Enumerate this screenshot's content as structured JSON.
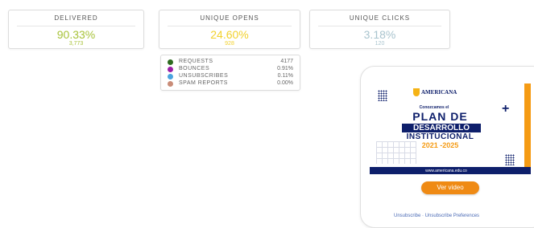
{
  "cards": [
    {
      "label": "DELIVERED",
      "value": "90.33%",
      "count": "3,773"
    },
    {
      "label": "UNIQUE OPENS",
      "value": "24.60%",
      "count": "928"
    },
    {
      "label": "UNIQUE CLICKS",
      "value": "3.18%",
      "count": "120"
    }
  ],
  "stats": [
    {
      "name": "REQUESTS",
      "value": "4177",
      "color": "#2d6a1f"
    },
    {
      "name": "BOUNCES",
      "value": "0.91%",
      "color": "#9b1fa6"
    },
    {
      "name": "UNSUBSCRIBES",
      "value": "0.11%",
      "color": "#4aa3df"
    },
    {
      "name": "SPAM REPORTS",
      "value": "0.00%",
      "color": "#c98c78"
    }
  ],
  "preview": {
    "logo_text": "AMERICANA",
    "small_heading": "Conozcamos el",
    "plan": "PLAN DE",
    "desarrollo": "DESARROLLO",
    "institucional": "INSTITUCIONAL",
    "years": "2021 -2025",
    "url": "www.americana.edu.co",
    "button": "Ver video",
    "links": "Unsubscribe · Unsubscribe Preferences"
  }
}
